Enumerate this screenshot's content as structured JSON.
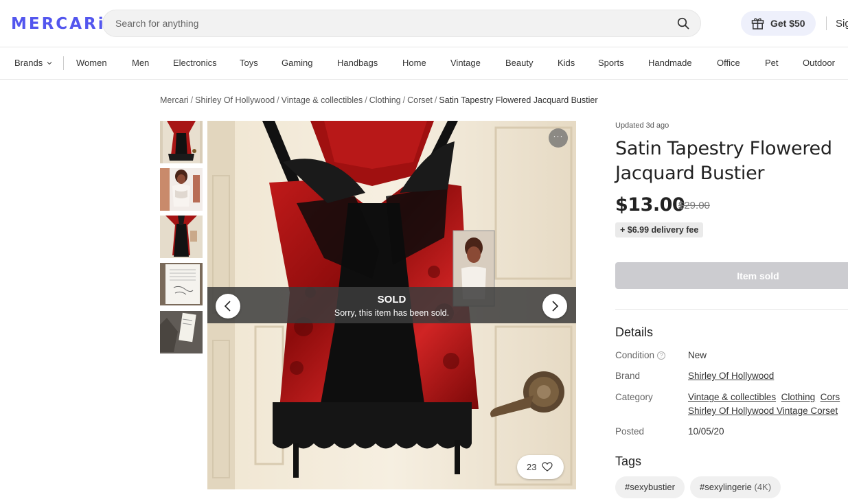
{
  "header": {
    "logo": "MERCARi",
    "search_placeholder": "Search for anything",
    "promo_label": "Get $50",
    "signin_label": "Sig"
  },
  "categories": [
    {
      "label": "Brands"
    },
    {
      "label": "Women"
    },
    {
      "label": "Men"
    },
    {
      "label": "Electronics"
    },
    {
      "label": "Toys"
    },
    {
      "label": "Gaming"
    },
    {
      "label": "Handbags"
    },
    {
      "label": "Home"
    },
    {
      "label": "Vintage"
    },
    {
      "label": "Beauty"
    },
    {
      "label": "Kids"
    },
    {
      "label": "Sports"
    },
    {
      "label": "Handmade"
    },
    {
      "label": "Office"
    },
    {
      "label": "Pet"
    },
    {
      "label": "Outdoor"
    }
  ],
  "breadcrumb": [
    "Mercari",
    "Shirley Of Hollywood",
    "Vintage & collectibles",
    "Clothing",
    "Corset",
    "Satin Tapestry Flowered Jacquard Bustier"
  ],
  "gallery": {
    "sold_title": "SOLD",
    "sold_subtitle": "Sorry, this item has been sold.",
    "more_label": "···",
    "like_count": "23"
  },
  "item": {
    "updated": "Updated 3d ago",
    "title": "Satin Tapestry Flowered Jacquard Bustier",
    "price": "$13.00",
    "original_price": "$29.00",
    "delivery_fee": "+ $6.99 delivery fee",
    "sold_button": "Item sold"
  },
  "details": {
    "heading": "Details",
    "condition_label": "Condition",
    "condition_value": "New",
    "brand_label": "Brand",
    "brand_value": "Shirley Of Hollywood",
    "category_label": "Category",
    "category_links": [
      "Vintage & collectibles",
      "Clothing",
      "Cors"
    ],
    "category_line2": "Shirley Of Hollywood Vintage Corset",
    "posted_label": "Posted",
    "posted_value": "10/05/20"
  },
  "tags": {
    "heading": "Tags",
    "items": [
      {
        "label": "#sexybustier",
        "count": ""
      },
      {
        "label": "#sexylingerie",
        "count": "(4K)"
      }
    ]
  },
  "colors": {
    "brand": "#5356ee",
    "sold_button": "#ccccd0",
    "garment_red": "#b01818"
  }
}
